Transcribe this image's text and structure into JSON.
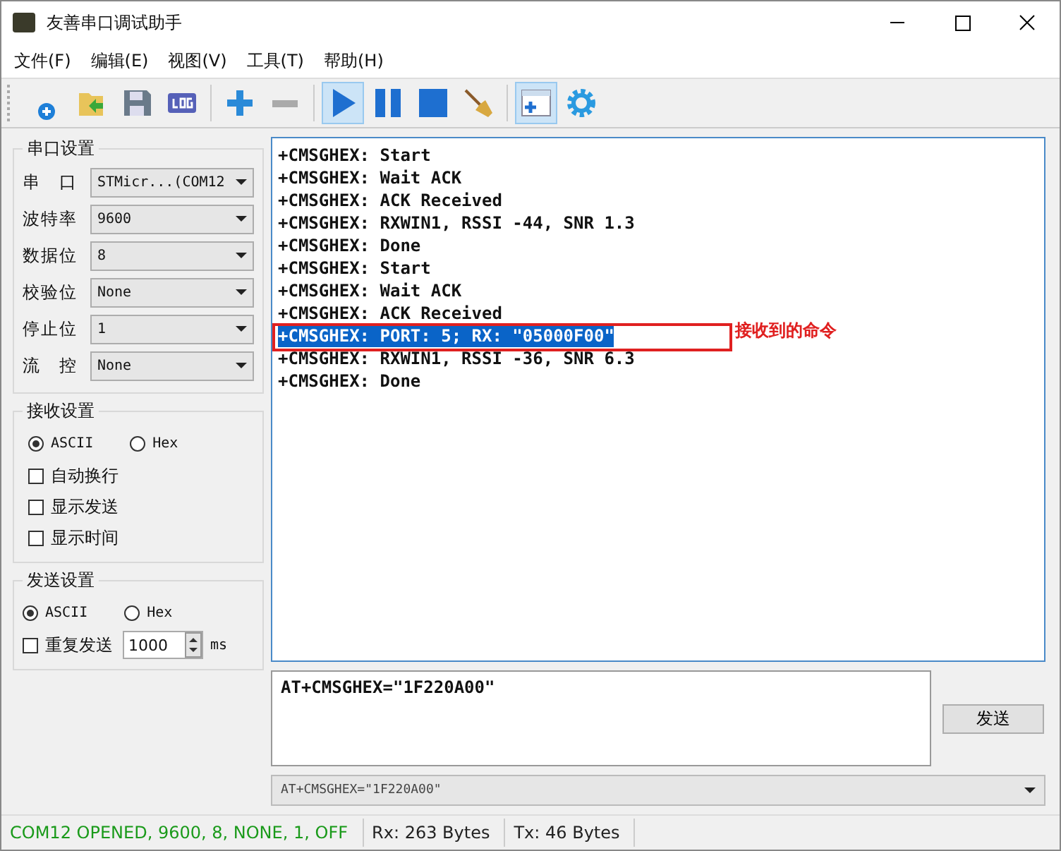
{
  "window": {
    "title": "友善串口调试助手"
  },
  "menu": [
    "文件(F)",
    "编辑(E)",
    "视图(V)",
    "工具(T)",
    "帮助(H)"
  ],
  "toolbar": [
    {
      "kind": "new",
      "pressed": false
    },
    {
      "kind": "open",
      "pressed": false
    },
    {
      "kind": "save",
      "pressed": false
    },
    {
      "kind": "log",
      "pressed": false
    },
    {
      "kind": "sep"
    },
    {
      "kind": "add",
      "pressed": false
    },
    {
      "kind": "remove",
      "pressed": false
    },
    {
      "kind": "sep"
    },
    {
      "kind": "play",
      "pressed": true
    },
    {
      "kind": "pause",
      "pressed": false
    },
    {
      "kind": "stop",
      "pressed": false
    },
    {
      "kind": "broom",
      "pressed": false
    },
    {
      "kind": "sep"
    },
    {
      "kind": "panel",
      "pressed": true
    },
    {
      "kind": "gear",
      "pressed": false
    }
  ],
  "serial_settings": {
    "title": "串口设置",
    "fields": [
      {
        "label": "串　口",
        "value": "STMicr...(COM12"
      },
      {
        "label": "波特率",
        "value": "9600"
      },
      {
        "label": "数据位",
        "value": "8"
      },
      {
        "label": "校验位",
        "value": "None"
      },
      {
        "label": "停止位",
        "value": "1"
      },
      {
        "label": "流　控",
        "value": "None"
      }
    ]
  },
  "receive_settings": {
    "title": "接收设置",
    "radios": [
      {
        "label": "ASCII",
        "selected": true
      },
      {
        "label": "Hex",
        "selected": false
      }
    ],
    "checkboxes": [
      {
        "label": "自动换行",
        "checked": false
      },
      {
        "label": "显示发送",
        "checked": false
      },
      {
        "label": "显示时间",
        "checked": false
      }
    ]
  },
  "send_settings": {
    "title": "发送设置",
    "radios": [
      {
        "label": "ASCII",
        "selected": true
      },
      {
        "label": "Hex",
        "selected": false
      }
    ],
    "repeat": {
      "label": "重复发送",
      "checked": false,
      "value": "1000",
      "unit": "ms"
    }
  },
  "log": [
    {
      "text": "+CMSGHEX: Start",
      "selected": false
    },
    {
      "text": "+CMSGHEX: Wait ACK",
      "selected": false
    },
    {
      "text": "+CMSGHEX: ACK Received",
      "selected": false
    },
    {
      "text": "+CMSGHEX: RXWIN1, RSSI -44, SNR 1.3",
      "selected": false
    },
    {
      "text": "+CMSGHEX: Done",
      "selected": false
    },
    {
      "text": "+CMSGHEX: Start",
      "selected": false
    },
    {
      "text": "+CMSGHEX: Wait ACK",
      "selected": false
    },
    {
      "text": "+CMSGHEX: ACK Received",
      "selected": false
    },
    {
      "text": "+CMSGHEX: PORT: 5; RX: \"05000F00\"",
      "selected": true,
      "annotation": "接收到的命令"
    },
    {
      "text": "+CMSGHEX: RXWIN1, RSSI -36, SNR 6.3",
      "selected": false
    },
    {
      "text": "+CMSGHEX: Done",
      "selected": false
    }
  ],
  "send_input": {
    "value": "AT+CMSGHEX=\"1F220A00\""
  },
  "send_button": "发送",
  "history": {
    "value": "AT+CMSGHEX=\"1F220A00\""
  },
  "status_bar": [
    {
      "text": "COM12 OPENED, 9600, 8, NONE, 1, OFF",
      "color": "#1a9a1a"
    },
    {
      "text": "Rx: 263 Bytes",
      "color": "#222222"
    },
    {
      "text": "Tx: 46 Bytes",
      "color": "#222222"
    }
  ]
}
